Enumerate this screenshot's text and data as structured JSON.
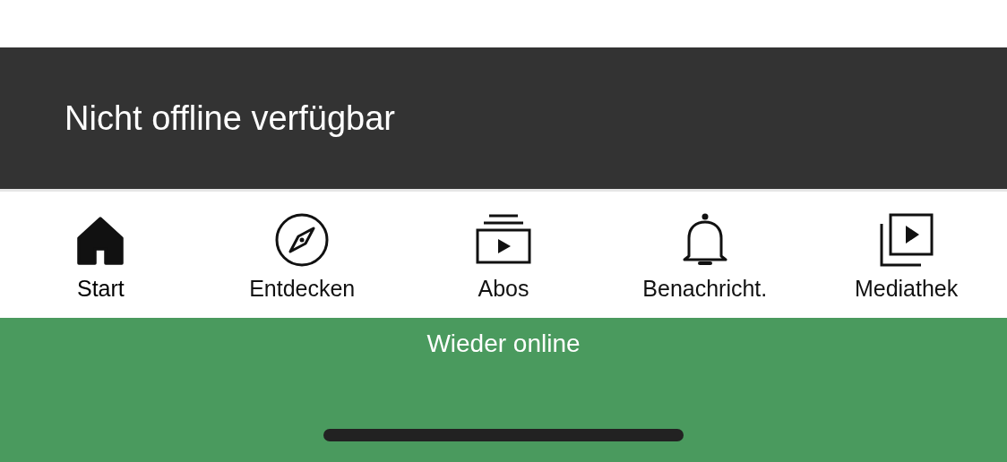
{
  "snackbar": {
    "message": "Nicht offline verfügbar"
  },
  "tabs": [
    {
      "kind": "home",
      "label": "Start",
      "selected": true
    },
    {
      "kind": "explore",
      "label": "Entdecken",
      "selected": false
    },
    {
      "kind": "subscriptions",
      "label": "Abos",
      "selected": false
    },
    {
      "kind": "notifications",
      "label": "Benachricht.",
      "selected": false
    },
    {
      "kind": "library",
      "label": "Mediathek",
      "selected": false
    }
  ],
  "status_banner": {
    "text": "Wieder online"
  }
}
